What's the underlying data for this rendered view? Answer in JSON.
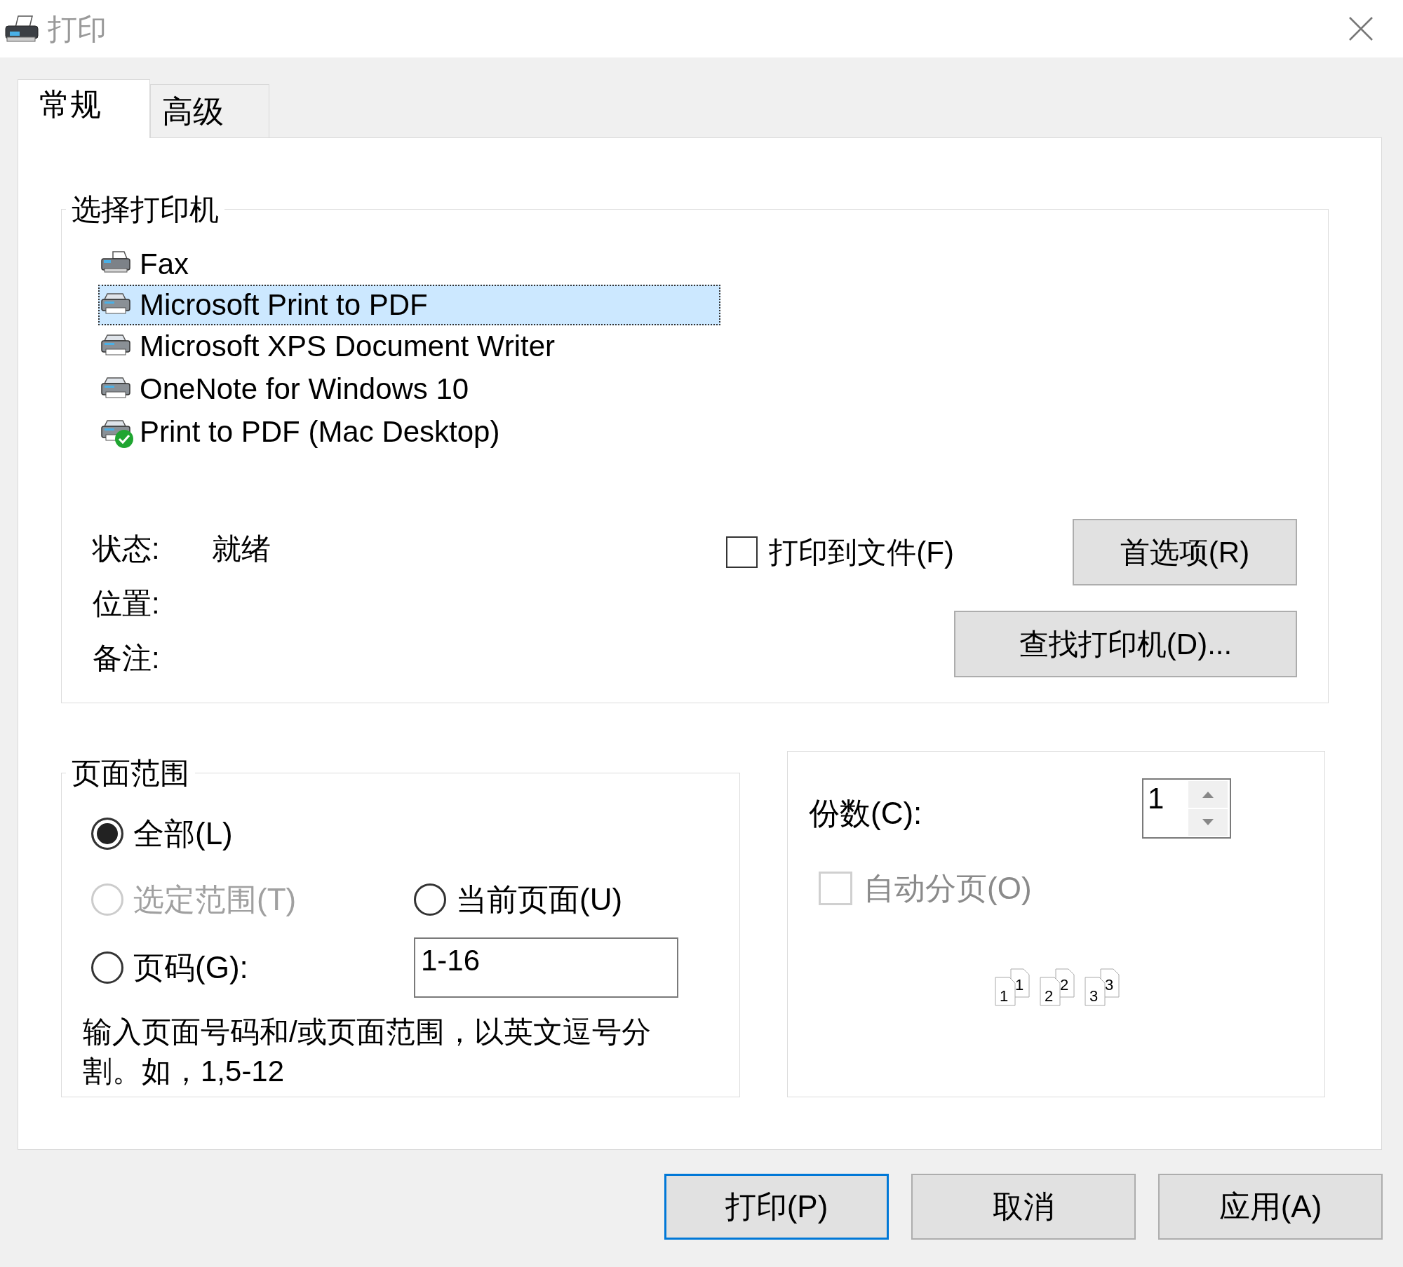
{
  "window": {
    "title": "打印"
  },
  "tabs": [
    {
      "label": "常规",
      "selected": true
    },
    {
      "label": "高级",
      "selected": false
    }
  ],
  "printer_group": {
    "title": "选择打印机",
    "printers": [
      {
        "name": "Fax",
        "kind": "fax",
        "selected": false,
        "default": false
      },
      {
        "name": "Microsoft Print to PDF",
        "kind": "printer",
        "selected": true,
        "default": false
      },
      {
        "name": "Microsoft XPS Document Writer",
        "kind": "printer",
        "selected": false,
        "default": false
      },
      {
        "name": "OneNote for Windows 10",
        "kind": "printer",
        "selected": false,
        "default": false
      },
      {
        "name": "Print to PDF (Mac Desktop)",
        "kind": "printer",
        "selected": false,
        "default": true
      }
    ],
    "status": [
      {
        "label": "状态:",
        "value": "就绪"
      },
      {
        "label": "位置:"
      },
      {
        "label": "备注:"
      }
    ],
    "print_to_file": {
      "label": "打印到文件(F)",
      "checked": false
    },
    "preferences_button": "首选项(R)",
    "find_printer_button": "查找打印机(D)..."
  },
  "page_range": {
    "title": "页面范围",
    "options": [
      {
        "label": "全部(L)",
        "selected": true,
        "disabled": false
      },
      {
        "label": "选定范围(T)",
        "selected": false,
        "disabled": true
      },
      {
        "label": "当前页面(U)",
        "selected": false,
        "disabled": false
      },
      {
        "label": "页码(G):",
        "selected": false,
        "disabled": false
      }
    ],
    "pages_field": {
      "value": "1-16"
    },
    "hint": "输入页面号码和/或页面范围，以英文逗号分割。如，1,5-12"
  },
  "copies": {
    "label": "份数(C):",
    "value": "1",
    "collate": {
      "label": "自动分页(O)",
      "checked": false,
      "disabled": true,
      "preview_pages": [
        {
          "front": "1",
          "back": "1"
        },
        {
          "front": "2",
          "back": "2"
        },
        {
          "front": "3",
          "back": "3"
        }
      ]
    }
  },
  "dialog_buttons": [
    {
      "label": "打印(P)",
      "default": true
    },
    {
      "label": "取消",
      "default": false
    },
    {
      "label": "应用(A)",
      "default": false
    }
  ]
}
